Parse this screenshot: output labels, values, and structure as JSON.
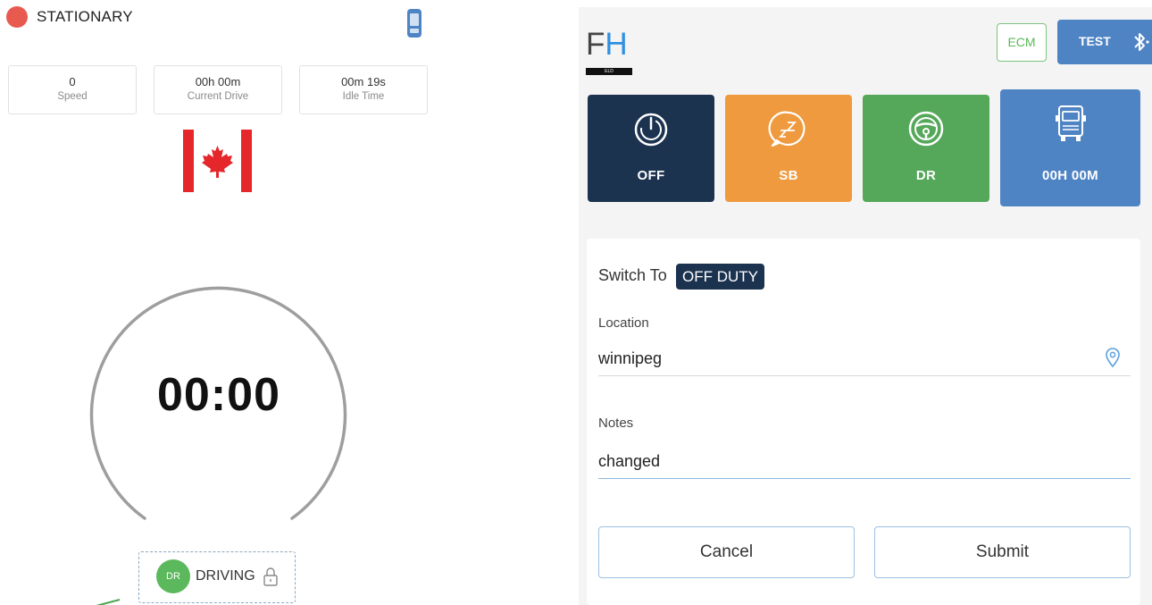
{
  "left": {
    "status": "STATIONARY",
    "stats": [
      {
        "value": "0",
        "label": "Speed"
      },
      {
        "value": "00h 00m",
        "label": "Current Drive"
      },
      {
        "value": "00m 19s",
        "label": "Idle Time"
      }
    ],
    "flag_icon": "canada-flag",
    "timer": "00:00",
    "driving": {
      "badge": "DR",
      "label": "DRIVING"
    },
    "colors": {
      "status_dot": "#e85a4f",
      "dr_badge": "#5cb85c"
    }
  },
  "right": {
    "logo": {
      "f": "F",
      "h": "H",
      "bar_text": "ELD"
    },
    "ecm_label": "ECM",
    "test_label": "TEST",
    "tiles": [
      {
        "label": "OFF",
        "icon": "power-icon",
        "color": "#1c3350"
      },
      {
        "label": "SB",
        "icon": "sleep-icon",
        "color": "#ef9a3e"
      },
      {
        "label": "DR",
        "icon": "steering-wheel-icon",
        "color": "#55a85a"
      },
      {
        "label": "00H 00M",
        "icon": "truck-icon",
        "color": "#4f84c4"
      }
    ],
    "form": {
      "switch_label": "Switch To",
      "switch_value": "OFF DUTY",
      "location_label": "Location",
      "location_value": "winnipeg",
      "notes_label": "Notes",
      "notes_value": "changed",
      "cancel_label": "Cancel",
      "submit_label": "Submit"
    }
  }
}
